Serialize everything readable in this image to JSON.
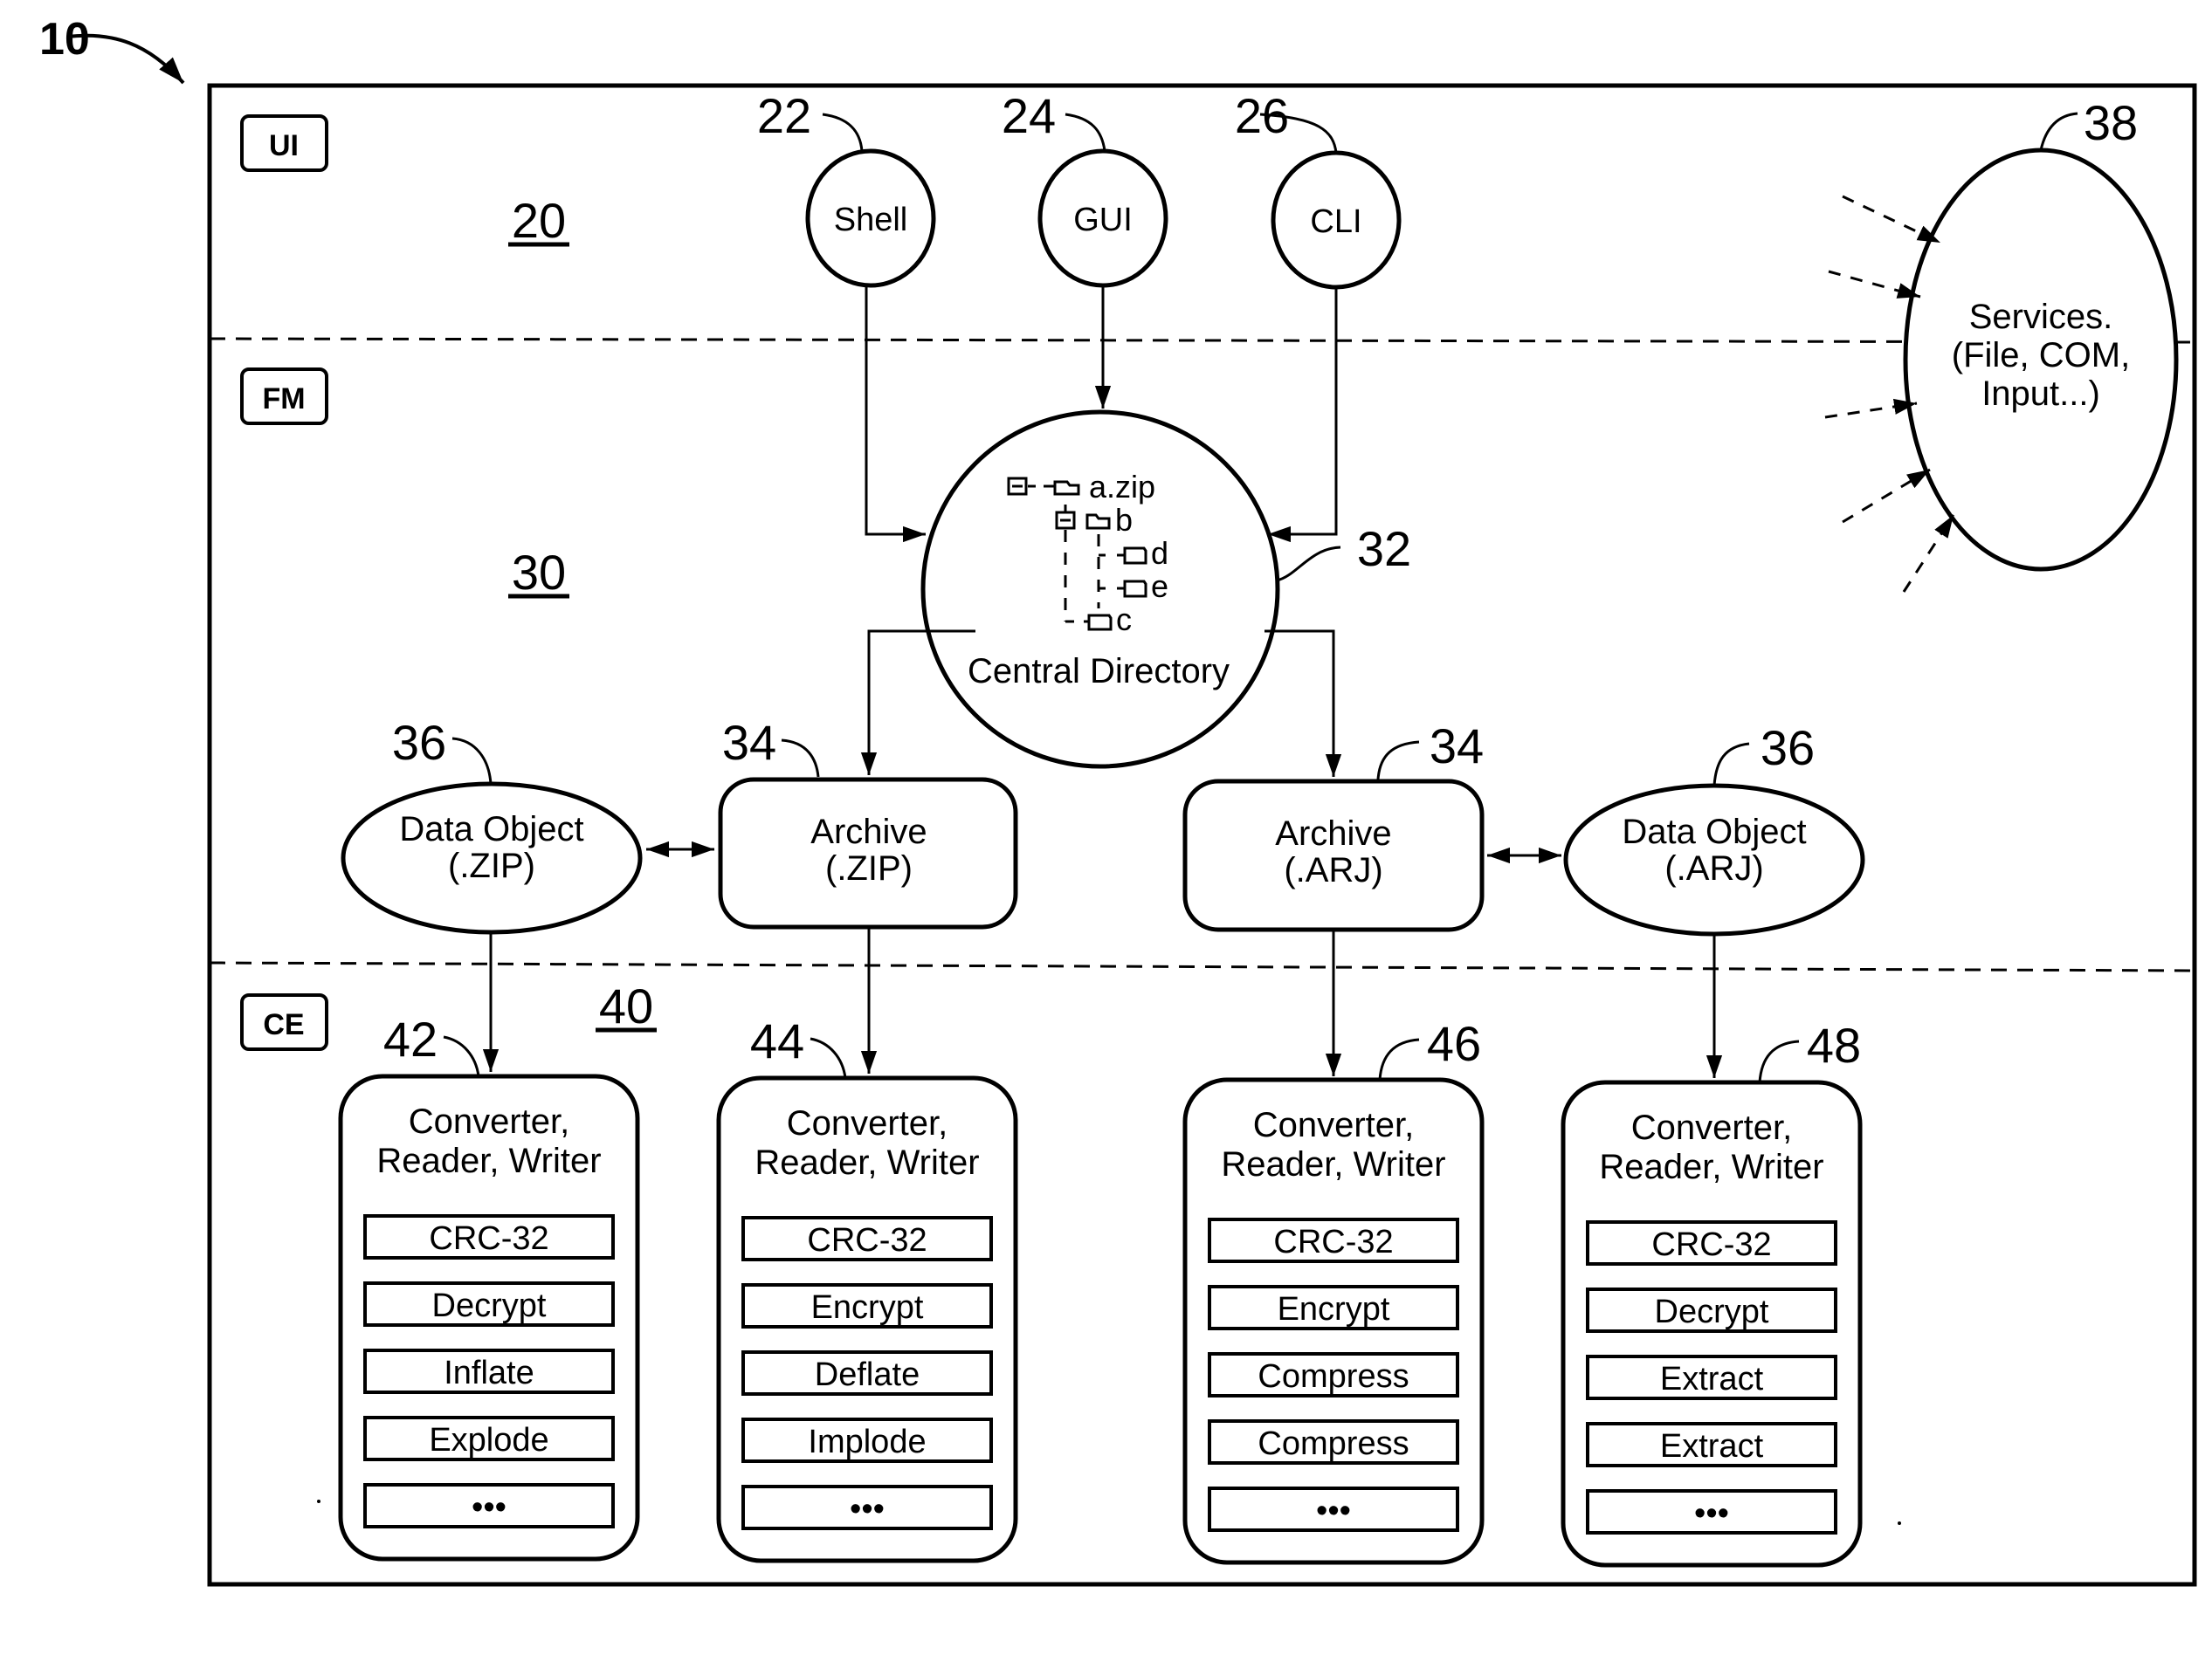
{
  "figure": {
    "ref": "10",
    "layers": [
      {
        "tag": "UI",
        "ref": "20"
      },
      {
        "tag": "FM",
        "ref": "30"
      },
      {
        "tag": "CE",
        "ref": "40"
      }
    ]
  },
  "ui_nodes": [
    {
      "label": "Shell",
      "ref": "22"
    },
    {
      "label": "GUI",
      "ref": "24"
    },
    {
      "label": "CLI",
      "ref": "26"
    }
  ],
  "services": {
    "ref": "38",
    "lines": [
      "Services.",
      "(File, COM,",
      "Input...)"
    ]
  },
  "central_directory": {
    "ref": "32",
    "title": "Central Directory",
    "tree": [
      "a.zip",
      "b",
      "d",
      "e",
      "c"
    ]
  },
  "archives": [
    {
      "ref": "34",
      "lines": [
        "Archive",
        "(.ZIP)"
      ]
    },
    {
      "ref": "34",
      "lines": [
        "Archive",
        "(.ARJ)"
      ]
    }
  ],
  "data_objects": [
    {
      "ref": "36",
      "lines": [
        "Data Object",
        "(.ZIP)"
      ]
    },
    {
      "ref": "36",
      "lines": [
        "Data Object",
        "(.ARJ)"
      ]
    }
  ],
  "engines": [
    {
      "ref": "42",
      "title": [
        "Converter,",
        "Reader, Writer"
      ],
      "items": [
        "CRC-32",
        "Decrypt",
        "Inflate",
        "Explode",
        "•••"
      ]
    },
    {
      "ref": "44",
      "title": [
        "Converter,",
        "Reader, Writer"
      ],
      "items": [
        "CRC-32",
        "Encrypt",
        "Deflate",
        "Implode",
        "•••"
      ]
    },
    {
      "ref": "46",
      "title": [
        "Converter,",
        "Reader, Writer"
      ],
      "items": [
        "CRC-32",
        "Encrypt",
        "Compress",
        "Compress",
        "•••"
      ]
    },
    {
      "ref": "48",
      "title": [
        "Converter,",
        "Reader, Writer"
      ],
      "items": [
        "CRC-32",
        "Decrypt",
        "Extract",
        "Extract",
        "•••"
      ]
    }
  ]
}
